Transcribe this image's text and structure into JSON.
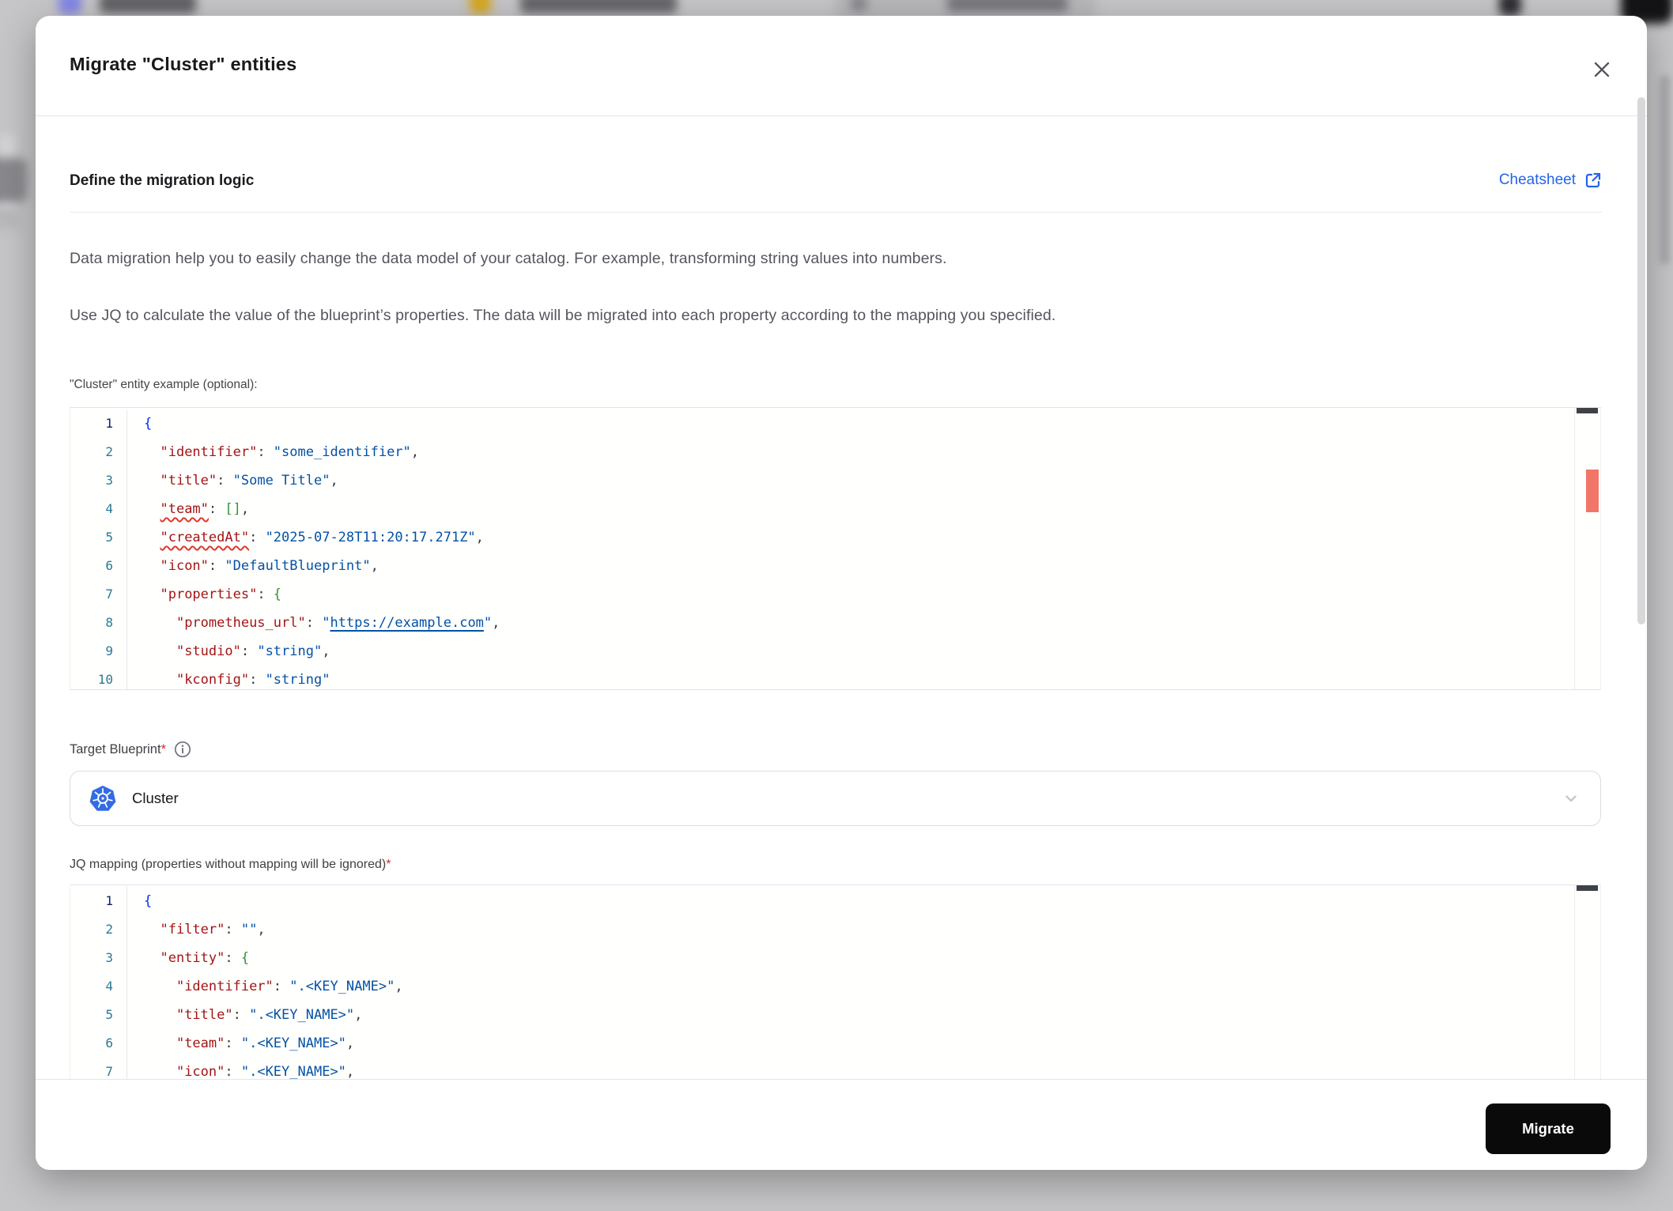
{
  "modal": {
    "title": "Migrate \"Cluster\" entities"
  },
  "section": {
    "heading": "Define the migration logic",
    "cheatsheet_label": "Cheatsheet"
  },
  "intro": {
    "paragraph1": "Data migration help you to easily change the data model of your catalog. For example, transforming string values into numbers.",
    "paragraph2": "Use JQ to calculate the value of the blueprint’s properties. The data will be migrated into each property according to the mapping you specified."
  },
  "example_editor": {
    "label": "\"Cluster\" entity example (optional):",
    "lines": [
      {
        "n": 1,
        "active": true,
        "tokens": [
          [
            "b1",
            "{"
          ]
        ]
      },
      {
        "n": 2,
        "tokens": [
          [
            "pl",
            "  "
          ],
          [
            "k",
            "\"identifier\""
          ],
          [
            "p",
            ": "
          ],
          [
            "s",
            "\"some_identifier\""
          ],
          [
            "p",
            ","
          ]
        ]
      },
      {
        "n": 3,
        "tokens": [
          [
            "pl",
            "  "
          ],
          [
            "k",
            "\"title\""
          ],
          [
            "p",
            ": "
          ],
          [
            "s",
            "\"Some Title\""
          ],
          [
            "p",
            ","
          ]
        ]
      },
      {
        "n": 4,
        "tokens": [
          [
            "pl",
            "  "
          ],
          [
            "ks",
            "\"team\""
          ],
          [
            "p",
            ": "
          ],
          [
            "b2",
            "[]"
          ],
          [
            "p",
            ","
          ]
        ]
      },
      {
        "n": 5,
        "tokens": [
          [
            "pl",
            "  "
          ],
          [
            "ks",
            "\"createdAt\""
          ],
          [
            "p",
            ": "
          ],
          [
            "s",
            "\"2025-07-28T11:20:17.271Z\""
          ],
          [
            "p",
            ","
          ]
        ]
      },
      {
        "n": 6,
        "tokens": [
          [
            "pl",
            "  "
          ],
          [
            "k",
            "\"icon\""
          ],
          [
            "p",
            ": "
          ],
          [
            "s",
            "\"DefaultBlueprint\""
          ],
          [
            "p",
            ","
          ]
        ]
      },
      {
        "n": 7,
        "tokens": [
          [
            "pl",
            "  "
          ],
          [
            "k",
            "\"properties\""
          ],
          [
            "p",
            ": "
          ],
          [
            "b2",
            "{"
          ]
        ]
      },
      {
        "n": 8,
        "tokens": [
          [
            "pl",
            "    "
          ],
          [
            "k",
            "\"prometheus_url\""
          ],
          [
            "p",
            ": "
          ],
          [
            "s",
            "\""
          ],
          [
            "u",
            "https://example.com"
          ],
          [
            "s",
            "\""
          ],
          [
            "p",
            ","
          ]
        ]
      },
      {
        "n": 9,
        "tokens": [
          [
            "pl",
            "    "
          ],
          [
            "k",
            "\"studio\""
          ],
          [
            "p",
            ": "
          ],
          [
            "s",
            "\"string\""
          ],
          [
            "p",
            ","
          ]
        ]
      },
      {
        "n": 10,
        "tokens": [
          [
            "pl",
            "    "
          ],
          [
            "k",
            "\"kconfig\""
          ],
          [
            "p",
            ": "
          ],
          [
            "s",
            "\"string\""
          ]
        ]
      }
    ]
  },
  "target_blueprint": {
    "label": "Target Blueprint",
    "required_mark": "*",
    "value": "Cluster"
  },
  "jq_editor": {
    "label": "JQ mapping (properties without mapping will be ignored)",
    "required_mark": "*",
    "lines": [
      {
        "n": 1,
        "active": true,
        "tokens": [
          [
            "b1",
            "{"
          ]
        ]
      },
      {
        "n": 2,
        "tokens": [
          [
            "pl",
            "  "
          ],
          [
            "k",
            "\"filter\""
          ],
          [
            "p",
            ": "
          ],
          [
            "s",
            "\"\""
          ],
          [
            "p",
            ","
          ]
        ]
      },
      {
        "n": 3,
        "tokens": [
          [
            "pl",
            "  "
          ],
          [
            "k",
            "\"entity\""
          ],
          [
            "p",
            ": "
          ],
          [
            "b2",
            "{"
          ]
        ]
      },
      {
        "n": 4,
        "tokens": [
          [
            "pl",
            "    "
          ],
          [
            "k",
            "\"identifier\""
          ],
          [
            "p",
            ": "
          ],
          [
            "s",
            "\".<KEY_NAME>\""
          ],
          [
            "p",
            ","
          ]
        ]
      },
      {
        "n": 5,
        "tokens": [
          [
            "pl",
            "    "
          ],
          [
            "k",
            "\"title\""
          ],
          [
            "p",
            ": "
          ],
          [
            "s",
            "\".<KEY_NAME>\""
          ],
          [
            "p",
            ","
          ]
        ]
      },
      {
        "n": 6,
        "tokens": [
          [
            "pl",
            "    "
          ],
          [
            "k",
            "\"team\""
          ],
          [
            "p",
            ": "
          ],
          [
            "s",
            "\".<KEY_NAME>\""
          ],
          [
            "p",
            ","
          ]
        ]
      },
      {
        "n": 7,
        "tokens": [
          [
            "pl",
            "    "
          ],
          [
            "k",
            "\"icon\""
          ],
          [
            "p",
            ": "
          ],
          [
            "s",
            "\".<KEY_NAME>\""
          ],
          [
            "p",
            ","
          ]
        ]
      }
    ]
  },
  "footer": {
    "migrate_label": "Migrate"
  },
  "icons": {
    "close": "close-icon",
    "external_link": "external-link-icon",
    "info": "info-icon",
    "chevron_down": "chevron-down-icon",
    "kubernetes": "kubernetes-icon"
  },
  "colors": {
    "link_blue": "#2563eb",
    "kubernetes_blue": "#326ce5",
    "code_key": "#a31515",
    "code_string": "#0451a5",
    "bracket_blue": "#0431fa",
    "bracket_green": "#319331",
    "squiggle_red": "#e0382b",
    "overview_error": "#f2756a",
    "required_red": "#dc2626",
    "button_black": "#0a0a0b"
  }
}
